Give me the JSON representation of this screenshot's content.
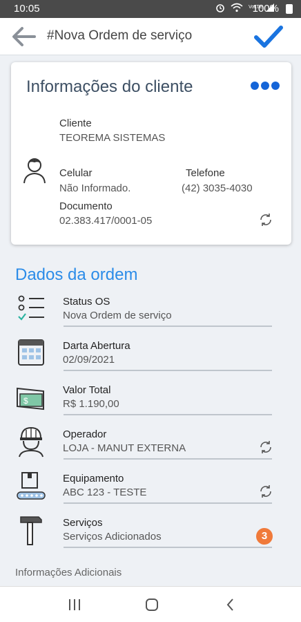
{
  "status_bar": {
    "time": "10:05",
    "battery": "100%",
    "network": "VoLTE"
  },
  "header": {
    "title": "#Nova Ordem de serviço",
    "back_icon": "arrow-left-icon",
    "confirm_icon": "check-icon"
  },
  "client_card": {
    "title": "Informações do cliente",
    "cliente_label": "Cliente",
    "cliente_value": "TEOREMA SISTEMAS",
    "celular_label": "Celular",
    "celular_value": "Não Informado.",
    "telefone_label": "Telefone",
    "telefone_value": "(42) 3035-4030",
    "documento_label": "Documento",
    "documento_value": "02.383.417/0001-05"
  },
  "order": {
    "section_title": "Dados da ordem",
    "fields": [
      {
        "label": "Status OS",
        "value": "Nova Ordem de serviço",
        "icon": "checklist-icon"
      },
      {
        "label": "Darta Abertura",
        "value": "02/09/2021",
        "icon": "calendar-icon"
      },
      {
        "label": "Valor Total",
        "value": "R$ 1.190,00",
        "icon": "money-icon"
      },
      {
        "label": "Operador",
        "value": "LOJA - MANUT EXTERNA",
        "icon": "operator-helmet-icon"
      },
      {
        "label": "Equipamento",
        "value": "ABC 123 - TESTE",
        "icon": "box-conveyor-icon"
      },
      {
        "label": "Serviços",
        "value": "Serviços Adicionados",
        "icon": "hammer-icon",
        "badge": "3"
      }
    ]
  },
  "additional": {
    "label": "Informações Adicionais"
  },
  "colors": {
    "accent": "#2c8ce8",
    "dots": "#1565d8",
    "badge": "#f07a3a"
  }
}
